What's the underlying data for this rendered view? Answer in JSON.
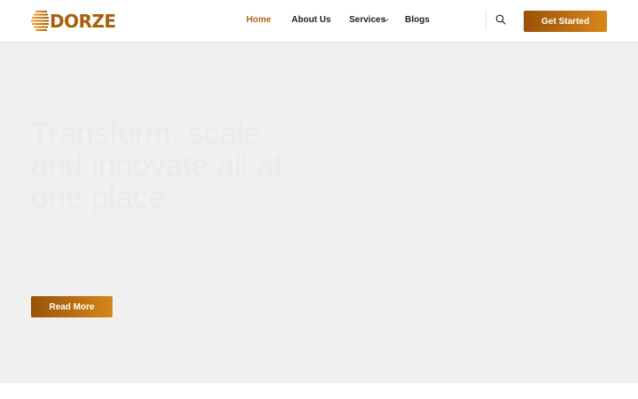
{
  "brand": {
    "logo_text": "DORZE",
    "color_primary": "#a95e0c",
    "color_gradient_start": "#9a5209",
    "color_gradient_end": "#d6871a"
  },
  "nav": {
    "items": [
      {
        "label": "Home",
        "active": true
      },
      {
        "label": "About Us",
        "active": false
      },
      {
        "label": "Services",
        "active": false,
        "has_dropdown": true
      },
      {
        "label": "Blogs",
        "active": false
      }
    ],
    "search_icon": "search-icon",
    "cta_label": "Get Started"
  },
  "hero": {
    "title": "Transform, scale and innovate all at one place.",
    "button_label": "Read More",
    "background": "#f0f0f0"
  }
}
